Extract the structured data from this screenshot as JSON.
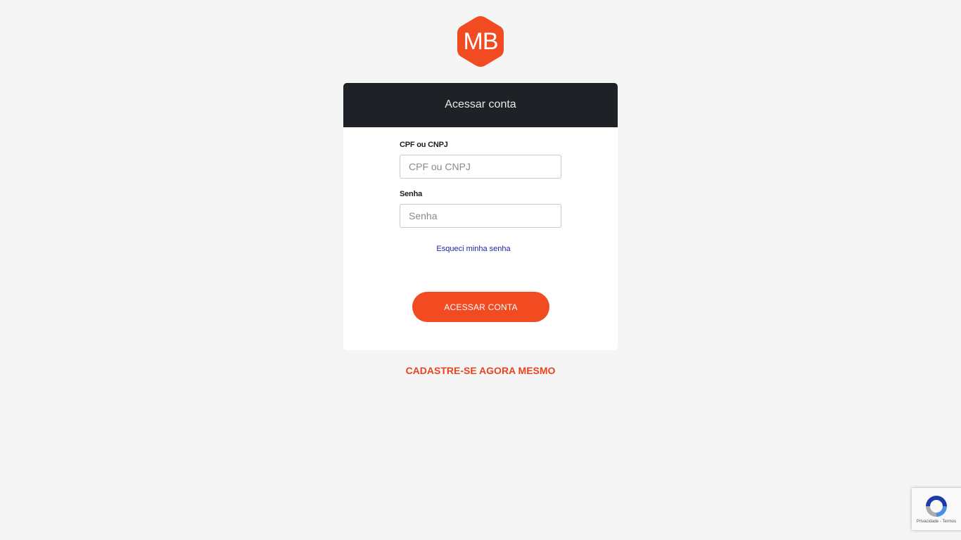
{
  "brand": {
    "logo_text": "MB",
    "accent_color": "#f24b22",
    "logo_color": "#f24b22"
  },
  "login": {
    "title": "Acessar conta",
    "cpf_label": "CPF ou CNPJ",
    "cpf_placeholder": "CPF ou CNPJ",
    "cpf_value": "",
    "password_label": "Senha",
    "password_placeholder": "Senha",
    "password_value": "",
    "forgot_password": "Esqueci minha senha",
    "submit_label": "ACESSAR CONTA"
  },
  "register": {
    "label": "CADASTRE-SE AGORA MESMO"
  },
  "recaptcha": {
    "icon": "recaptcha-icon",
    "footer_text": "Privacidade - Termos"
  }
}
